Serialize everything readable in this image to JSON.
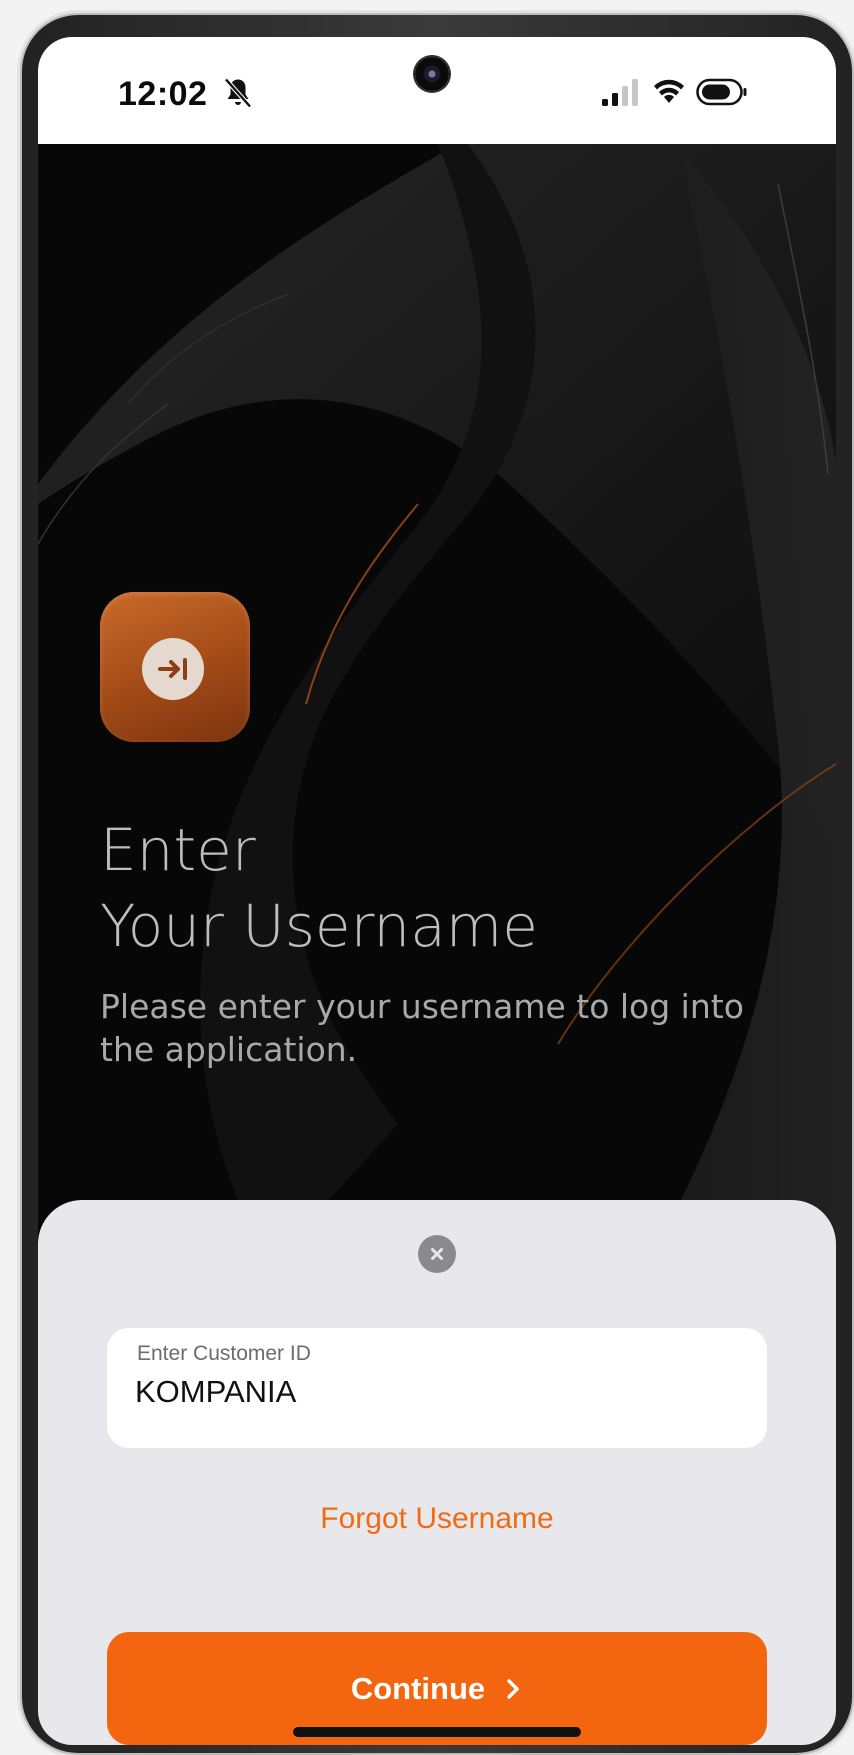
{
  "status_bar": {
    "time": "12:02",
    "icons": [
      "bell-muted-icon",
      "front-camera-icon",
      "cellular-signal-icon",
      "wifi-icon",
      "battery-icon"
    ]
  },
  "hero": {
    "tile_icon": "login-arrow-icon",
    "title_line1": "Enter",
    "title_line2": "Your Username",
    "subtitle": "Please enter your username to log into the application."
  },
  "sheet": {
    "close_icon": "close-icon",
    "customer_id": {
      "label": "Enter Customer ID",
      "value": "KOMPANIA"
    },
    "forgot_label": "Forgot Username",
    "continue_label": "Continue",
    "continue_icon": "chevron-right-icon"
  },
  "colors": {
    "accent": "#f4650f",
    "link": "#f06b13",
    "sheet_bg": "#e8e8ec",
    "screen_bg": "#050505",
    "tile": "#b0521c"
  }
}
